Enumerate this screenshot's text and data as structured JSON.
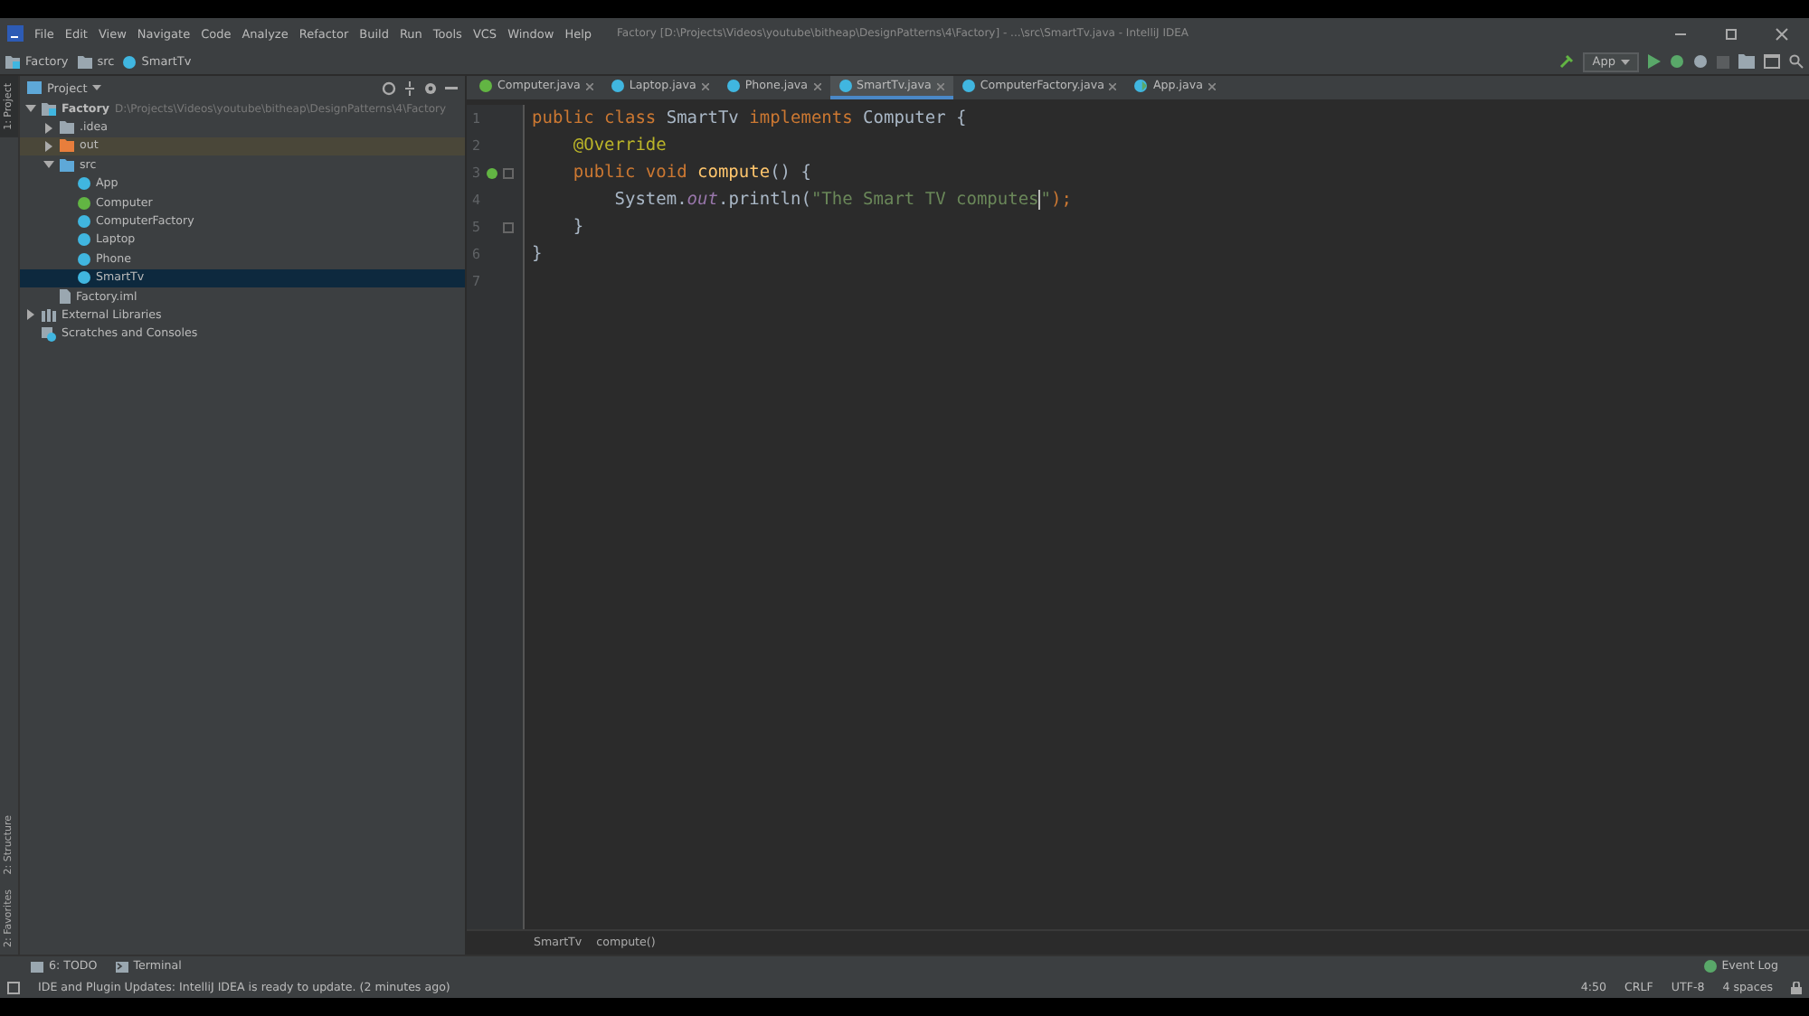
{
  "window": {
    "title": "Factory [D:\\Projects\\Videos\\youtube\\bitheap\\DesignPatterns\\4\\Factory] - ...\\src\\SmartTv.java - IntelliJ IDEA"
  },
  "menu": [
    "File",
    "Edit",
    "View",
    "Navigate",
    "Code",
    "Analyze",
    "Refactor",
    "Build",
    "Run",
    "Tools",
    "VCS",
    "Window",
    "Help"
  ],
  "nav_bar": [
    {
      "label": "Factory",
      "kind": "module"
    },
    {
      "label": "src",
      "kind": "folder"
    },
    {
      "label": "SmartTv",
      "kind": "class"
    }
  ],
  "run_config": {
    "label": "App"
  },
  "left_stripe": [
    {
      "label": "1: Project",
      "selected": true
    },
    {
      "label": "2: Structure",
      "selected": false
    },
    {
      "label": "2: Favorites",
      "selected": false
    }
  ],
  "project_panel": {
    "title": "Project",
    "tree": [
      {
        "label": "Factory",
        "path": "D:\\Projects\\Videos\\youtube\\bitheap\\DesignPatterns\\4\\Factory",
        "kind": "module",
        "expanded": true,
        "selected": false,
        "highlighted": false,
        "children": [
          {
            "label": ".idea",
            "kind": "folder",
            "expanded": false,
            "selected": false,
            "highlighted": false
          },
          {
            "label": "out",
            "kind": "excluded",
            "expanded": false,
            "selected": false,
            "highlighted": true
          },
          {
            "label": "src",
            "kind": "source",
            "expanded": true,
            "selected": false,
            "highlighted": false,
            "children": [
              {
                "label": "App",
                "kind": "class",
                "selected": false,
                "highlighted": false
              },
              {
                "label": "Computer",
                "kind": "interface",
                "selected": false,
                "highlighted": false
              },
              {
                "label": "ComputerFactory",
                "kind": "class",
                "selected": false,
                "highlighted": false
              },
              {
                "label": "Laptop",
                "kind": "class",
                "selected": false,
                "highlighted": false
              },
              {
                "label": "Phone",
                "kind": "class",
                "selected": false,
                "highlighted": false
              },
              {
                "label": "SmartTv",
                "kind": "class",
                "selected": true,
                "highlighted": false
              }
            ]
          },
          {
            "label": "Factory.iml",
            "kind": "file",
            "selected": false,
            "highlighted": false
          }
        ]
      },
      {
        "label": "External Libraries",
        "kind": "libraries",
        "expanded": false,
        "selected": false,
        "highlighted": false
      },
      {
        "label": "Scratches and Consoles",
        "kind": "scratches",
        "selected": false,
        "highlighted": false
      }
    ]
  },
  "tabs": [
    {
      "label": "Computer.java",
      "kind": "interface",
      "selected": false
    },
    {
      "label": "Laptop.java",
      "kind": "class",
      "selected": false
    },
    {
      "label": "Phone.java",
      "kind": "class",
      "selected": false
    },
    {
      "label": "SmartTv.java",
      "kind": "class",
      "selected": true
    },
    {
      "label": "ComputerFactory.java",
      "kind": "class",
      "selected": false
    },
    {
      "label": "App.java",
      "kind": "main",
      "selected": false
    }
  ],
  "editor": {
    "lines": [
      {
        "number": "1",
        "implements_marker": false,
        "fold_marker": false,
        "tokens": [
          {
            "text": "public class ",
            "kind": "keyword"
          },
          {
            "text": "SmartTv ",
            "kind": "plain"
          },
          {
            "text": "implements ",
            "kind": "keyword"
          },
          {
            "text": "Computer {",
            "kind": "plain"
          }
        ]
      },
      {
        "number": "2",
        "implements_marker": false,
        "fold_marker": false,
        "tokens": [
          {
            "text": "    @Override",
            "kind": "annotation"
          }
        ]
      },
      {
        "number": "3",
        "implements_marker": true,
        "fold_marker": true,
        "tokens": [
          {
            "text": "    public void ",
            "kind": "keyword"
          },
          {
            "text": "compute",
            "kind": "method"
          },
          {
            "text": "() {",
            "kind": "plain"
          }
        ]
      },
      {
        "number": "4",
        "implements_marker": false,
        "fold_marker": false,
        "tokens": [
          {
            "text": "        System.",
            "kind": "plain"
          },
          {
            "text": "out",
            "kind": "field"
          },
          {
            "text": ".println(",
            "kind": "plain"
          },
          {
            "text": "\"The Smart TV computes",
            "kind": "string",
            "caret": true
          },
          {
            "text": "\"",
            "kind": "string"
          },
          {
            "text": ");",
            "kind": "keyword"
          }
        ]
      },
      {
        "number": "5",
        "implements_marker": false,
        "fold_marker": true,
        "tokens": [
          {
            "text": "    }",
            "kind": "plain"
          }
        ]
      },
      {
        "number": "6",
        "implements_marker": false,
        "fold_marker": false,
        "tokens": [
          {
            "text": "}",
            "kind": "plain"
          }
        ]
      },
      {
        "number": "7",
        "implements_marker": false,
        "fold_marker": false
      }
    ],
    "breadcrumbs": [
      "SmartTv",
      "compute()"
    ]
  },
  "tool_windows": [
    {
      "label": "6: TODO",
      "kind": "todo"
    },
    {
      "label": "Terminal",
      "kind": "terminal"
    }
  ],
  "event_log": {
    "label": "Event Log"
  },
  "status_bar": {
    "message": "IDE and Plugin Updates: IntelliJ IDEA is ready to update. (2 minutes ago)",
    "items": [
      "4:50",
      "CRLF",
      "UTF-8",
      "4 spaces"
    ]
  }
}
